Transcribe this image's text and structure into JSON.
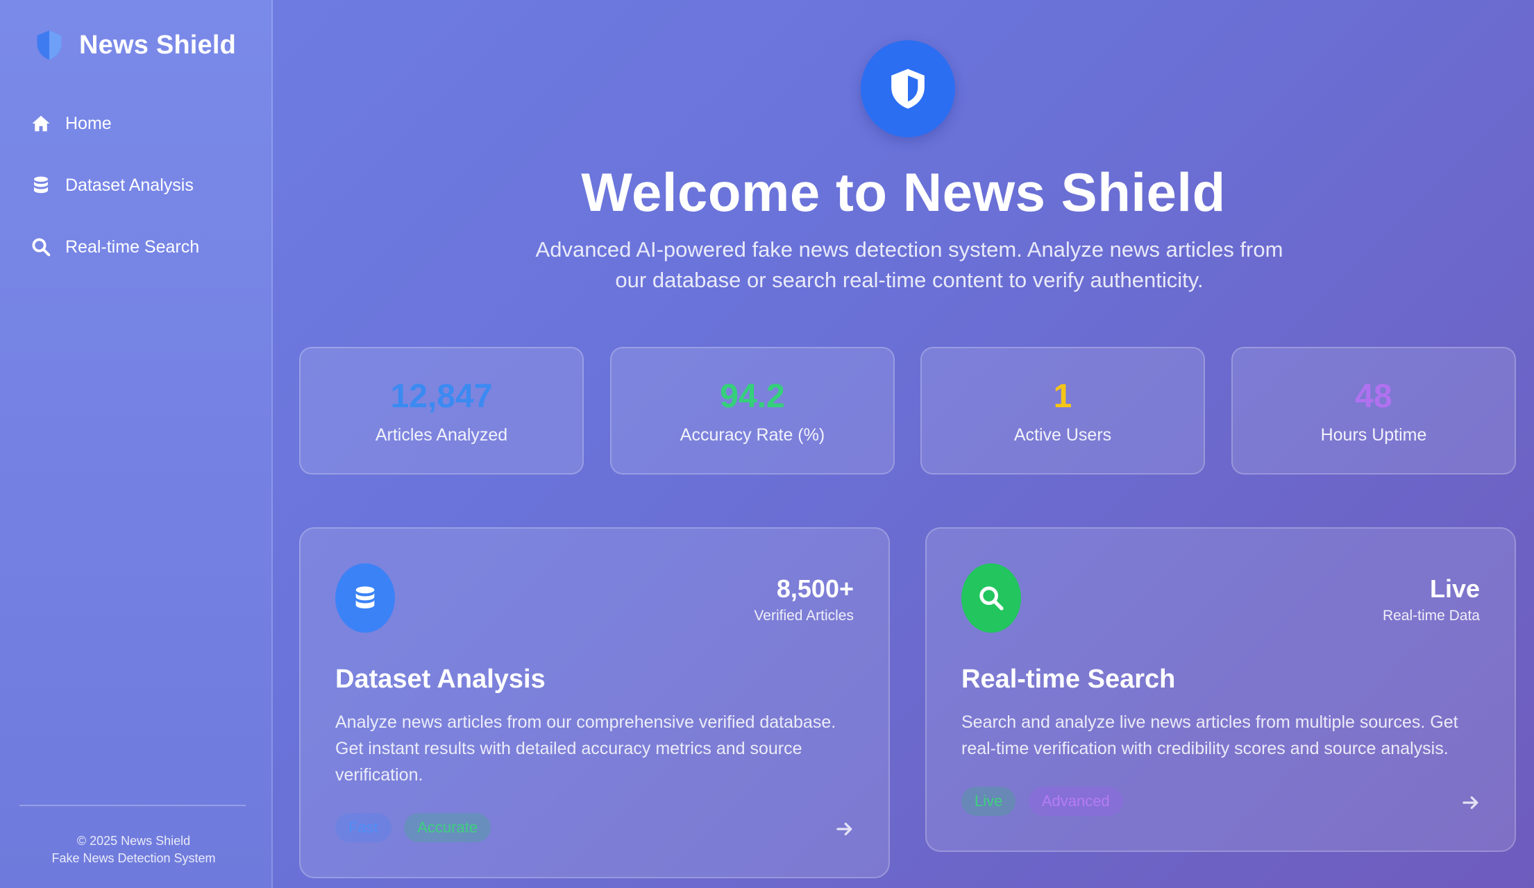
{
  "sidebar": {
    "brand": "News Shield",
    "nav": [
      {
        "label": "Home",
        "icon": "home-icon"
      },
      {
        "label": "Dataset Analysis",
        "icon": "database-icon"
      },
      {
        "label": "Real-time Search",
        "icon": "search-icon"
      }
    ],
    "footer_line1": "© 2025 News Shield",
    "footer_line2": "Fake News Detection System"
  },
  "hero": {
    "icon": "shield-icon",
    "title": "Welcome to News Shield",
    "subtitle": "Advanced AI-powered fake news detection system. Analyze news articles from our database or search real-time content to verify authenticity."
  },
  "stats": [
    {
      "value": "12,847",
      "label": "Articles Analyzed",
      "color": "#3b8af2"
    },
    {
      "value": "94.2",
      "label": "Accuracy Rate (%)",
      "color": "#34d17a"
    },
    {
      "value": "1",
      "label": "Active Users",
      "color": "#f5c518"
    },
    {
      "value": "48",
      "label": "Hours Uptime",
      "color": "#b071f0"
    }
  ],
  "features": [
    {
      "icon": "database-icon",
      "icon_color": "#3b82f6",
      "metric_value": "8,500+",
      "metric_label": "Verified Articles",
      "title": "Dataset Analysis",
      "description": "Analyze news articles from our comprehensive verified database. Get instant results with detailed accuracy metrics and source verification.",
      "tags": [
        "Fast",
        "Accurate"
      ]
    },
    {
      "icon": "search-icon",
      "icon_color": "#22c55e",
      "metric_value": "Live",
      "metric_label": "Real-time Data",
      "title": "Real-time Search",
      "description": "Search and analyze live news articles from multiple sources. Get real-time verification with credibility scores and source analysis.",
      "tags": [
        "Live",
        "Advanced"
      ]
    }
  ]
}
